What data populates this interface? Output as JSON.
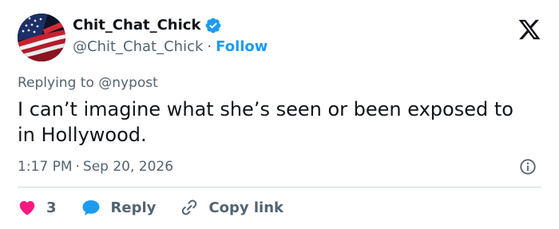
{
  "author": {
    "display_name": "Chit_Chat_Chick",
    "handle": "@Chit_Chat_Chick",
    "separator": "·",
    "follow_label": "Follow",
    "avatar_icon": "flag-avatar",
    "verified_icon": "verified-badge-icon"
  },
  "brand": {
    "logo_icon": "x-logo-icon"
  },
  "reply_context": {
    "text": "Replying to @nypost"
  },
  "tweet": {
    "text": "I can’t imagine what she’s seen or been exposed to in Hollywood.",
    "time": "1:17 PM",
    "separator": "·",
    "date": "Sep 20, 2026"
  },
  "actions": {
    "like_count": "3",
    "reply_label": "Reply",
    "copy_link_label": "Copy link",
    "like_icon": "heart-icon",
    "reply_icon": "speech-bubble-icon",
    "copy_icon": "link-icon",
    "info_icon": "info-icon"
  },
  "colors": {
    "accent": "#1d9bf0",
    "like": "#f91880",
    "text_primary": "#0f1419",
    "text_secondary": "#536471",
    "divider": "#cfd9de"
  }
}
